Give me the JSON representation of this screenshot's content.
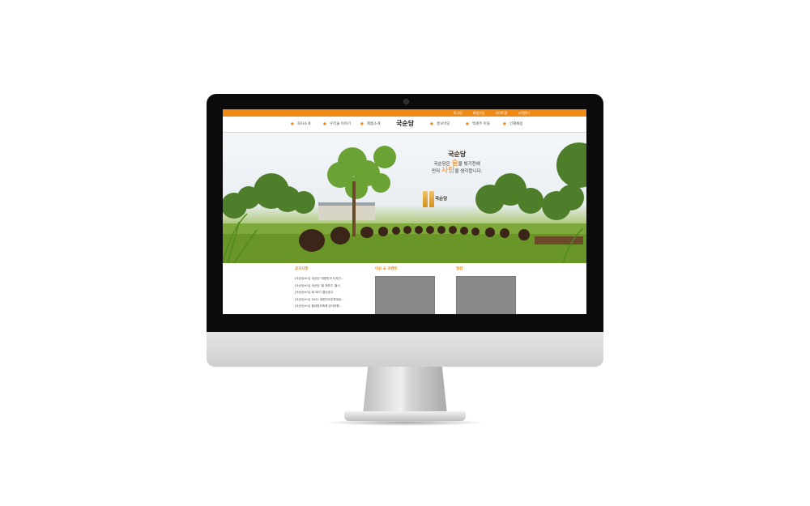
{
  "topbar": {
    "links": [
      "로그인",
      "회원가입",
      "사이트맵",
      "고객센터"
    ]
  },
  "nav": {
    "logo": "국순당",
    "items_left": [
      "회사소개",
      "우리술 이야기",
      "제품소개"
    ],
    "items_right": [
      "홍보마당",
      "백세주 마을",
      "인재채용"
    ]
  },
  "hero": {
    "logo": "국순당",
    "line1_pre": "국순당은 ",
    "line1_em": "술",
    "line1_post": "을 빚기전에",
    "line2_pre": "먼저 ",
    "line2_em": "사람",
    "line2_post": "을 생각합니다.",
    "bottle_logo": "국순당"
  },
  "sections": {
    "notice": {
      "title": "공지사항",
      "items": [
        "[국순당소식] 국순당 '대한민국 디자인...",
        "[국순당소식] 국순당 '별 과하주' 출시",
        "[국순당소식] 제 38기 결산공고",
        "[국순당소식] 2021 대한민국주류대상...",
        "[국순당소식] 횡성한우축제 공식후원..."
      ]
    },
    "events": {
      "title": "이슈 & 이벤트"
    },
    "video": {
      "title": "영상"
    }
  }
}
